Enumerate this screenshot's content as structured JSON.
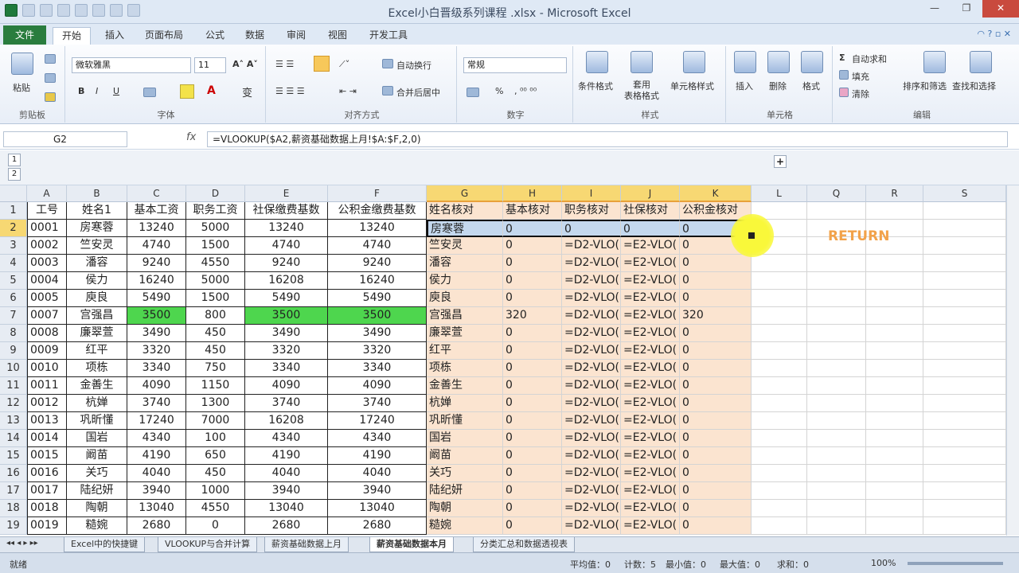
{
  "window": {
    "title": "Excel小白晋级系列课程 .xlsx - Microsoft Excel"
  },
  "tabs": [
    "文件",
    "开始",
    "插入",
    "页面布局",
    "公式",
    "数据",
    "审阅",
    "视图",
    "开发工具"
  ],
  "ribbon": {
    "clipboard": {
      "label": "剪贴板",
      "paste": "粘贴"
    },
    "font": {
      "label": "字体",
      "name": "微软雅黑",
      "size": "11",
      "bold": "B",
      "italic": "I",
      "underline": "U"
    },
    "alignment": {
      "label": "对齐方式",
      "wrap": "自动换行",
      "merge": "合并后居中"
    },
    "number": {
      "label": "数字",
      "format": "常规",
      "percent": "%"
    },
    "styles": {
      "label": "样式",
      "conditional": "条件格式",
      "table": "套用\n表格格式",
      "cell": "单元格样式"
    },
    "cells": {
      "label": "单元格",
      "insert": "插入",
      "delete": "删除",
      "format": "格式"
    },
    "editing": {
      "label": "编辑",
      "autosum": "自动求和",
      "fill": "填充",
      "clear": "清除",
      "sort": "排序和筛选",
      "find": "查找和选择"
    }
  },
  "formula": {
    "namebox": "G2",
    "fx": "fx",
    "content": "=VLOOKUP($A2,薪资基础数据上月!$A:$F,2,0)"
  },
  "outline": {
    "level1": "1",
    "level2": "2",
    "expand": "+"
  },
  "columns": [
    "A",
    "B",
    "C",
    "D",
    "E",
    "F",
    "G",
    "H",
    "I",
    "J",
    "K",
    "L",
    "Q",
    "R",
    "S"
  ],
  "headers": [
    "工号",
    "姓名1",
    "基本工资",
    "职务工资",
    "社保缴费基数",
    "公积金缴费基数",
    "姓名核对",
    "基本核对",
    "职务核对",
    "社保核对",
    "公积金核对"
  ],
  "rows": [
    {
      "n": "2",
      "a": "0001",
      "b": "房寒蓉",
      "c": "13240",
      "d": "5000",
      "e": "13240",
      "f": "13240",
      "g": "房寒蓉",
      "h": "0",
      "i": "0",
      "j": "0",
      "k": "0"
    },
    {
      "n": "3",
      "a": "0002",
      "b": "竺安灵",
      "c": "4740",
      "d": "1500",
      "e": "4740",
      "f": "4740",
      "g": "竺安灵",
      "h": "0",
      "i": "=D2-VLO(",
      "j": "=E2-VLO(",
      "k": "0"
    },
    {
      "n": "4",
      "a": "0003",
      "b": "潘容",
      "c": "9240",
      "d": "4550",
      "e": "9240",
      "f": "9240",
      "g": "潘容",
      "h": "0",
      "i": "=D2-VLO(",
      "j": "=E2-VLO(",
      "k": "0"
    },
    {
      "n": "5",
      "a": "0004",
      "b": "侯力",
      "c": "16240",
      "d": "5000",
      "e": "16208",
      "f": "16240",
      "g": "侯力",
      "h": "0",
      "i": "=D2-VLO(",
      "j": "=E2-VLO(",
      "k": "0"
    },
    {
      "n": "6",
      "a": "0005",
      "b": "庾良",
      "c": "5490",
      "d": "1500",
      "e": "5490",
      "f": "5490",
      "g": "庾良",
      "h": "0",
      "i": "=D2-VLO(",
      "j": "=E2-VLO(",
      "k": "0"
    },
    {
      "n": "7",
      "a": "0007",
      "b": "宫强昌",
      "c": "3500",
      "d": "800",
      "e": "3500",
      "f": "3500",
      "g": "宫强昌",
      "h": "320",
      "i": "=D2-VLO(",
      "j": "=E2-VLO(",
      "k": "320"
    },
    {
      "n": "8",
      "a": "0008",
      "b": "廉翠萱",
      "c": "3490",
      "d": "450",
      "e": "3490",
      "f": "3490",
      "g": "廉翠萱",
      "h": "0",
      "i": "=D2-VLO(",
      "j": "=E2-VLO(",
      "k": "0"
    },
    {
      "n": "9",
      "a": "0009",
      "b": "红平",
      "c": "3320",
      "d": "450",
      "e": "3320",
      "f": "3320",
      "g": "红平",
      "h": "0",
      "i": "=D2-VLO(",
      "j": "=E2-VLO(",
      "k": "0"
    },
    {
      "n": "10",
      "a": "0010",
      "b": "项栋",
      "c": "3340",
      "d": "750",
      "e": "3340",
      "f": "3340",
      "g": "项栋",
      "h": "0",
      "i": "=D2-VLO(",
      "j": "=E2-VLO(",
      "k": "0"
    },
    {
      "n": "11",
      "a": "0011",
      "b": "金善生",
      "c": "4090",
      "d": "1150",
      "e": "4090",
      "f": "4090",
      "g": "金善生",
      "h": "0",
      "i": "=D2-VLO(",
      "j": "=E2-VLO(",
      "k": "0"
    },
    {
      "n": "12",
      "a": "0012",
      "b": "杭婵",
      "c": "3740",
      "d": "1300",
      "e": "3740",
      "f": "3740",
      "g": "杭婵",
      "h": "0",
      "i": "=D2-VLO(",
      "j": "=E2-VLO(",
      "k": "0"
    },
    {
      "n": "13",
      "a": "0013",
      "b": "巩昕懂",
      "c": "17240",
      "d": "7000",
      "e": "16208",
      "f": "17240",
      "g": "巩昕懂",
      "h": "0",
      "i": "=D2-VLO(",
      "j": "=E2-VLO(",
      "k": "0"
    },
    {
      "n": "14",
      "a": "0014",
      "b": "国岩",
      "c": "4340",
      "d": "100",
      "e": "4340",
      "f": "4340",
      "g": "国岩",
      "h": "0",
      "i": "=D2-VLO(",
      "j": "=E2-VLO(",
      "k": "0"
    },
    {
      "n": "15",
      "a": "0015",
      "b": "阚苗",
      "c": "4190",
      "d": "650",
      "e": "4190",
      "f": "4190",
      "g": "阚苗",
      "h": "0",
      "i": "=D2-VLO(",
      "j": "=E2-VLO(",
      "k": "0"
    },
    {
      "n": "16",
      "a": "0016",
      "b": "关巧",
      "c": "4040",
      "d": "450",
      "e": "4040",
      "f": "4040",
      "g": "关巧",
      "h": "0",
      "i": "=D2-VLO(",
      "j": "=E2-VLO(",
      "k": "0"
    },
    {
      "n": "17",
      "a": "0017",
      "b": "陆纪妍",
      "c": "3940",
      "d": "1000",
      "e": "3940",
      "f": "3940",
      "g": "陆纪妍",
      "h": "0",
      "i": "=D2-VLO(",
      "j": "=E2-VLO(",
      "k": "0"
    },
    {
      "n": "18",
      "a": "0018",
      "b": "陶朝",
      "c": "13040",
      "d": "4550",
      "e": "13040",
      "f": "13040",
      "g": "陶朝",
      "h": "0",
      "i": "=D2-VLO(",
      "j": "=E2-VLO(",
      "k": "0"
    },
    {
      "n": "19",
      "a": "0019",
      "b": "糙婉",
      "c": "2680",
      "d": "0",
      "e": "2680",
      "f": "2680",
      "g": "糙婉",
      "h": "0",
      "i": "=D2-VLO(",
      "j": "=E2-VLO(",
      "k": "0"
    }
  ],
  "overlay": {
    "return_text": "RETURN"
  },
  "sheets": [
    "Excel中的快捷键",
    "VLOOKUP与合并计算",
    "薪资基础数据上月",
    "薪资基础数据本月",
    "分类汇总和数据透视表"
  ],
  "status": {
    "ready": "就绪",
    "average": "平均值：0",
    "count": "计数：5",
    "min": "最小值：0",
    "max": "最大值：0",
    "sum": "求和：0",
    "zoom": "100%"
  },
  "colors": {
    "file_tab": "#2a7d3e",
    "highlight_green": "#4ed64e",
    "peach": "#fbe4d0",
    "selection": "#c4d8ee",
    "return": "#f2a24a"
  }
}
